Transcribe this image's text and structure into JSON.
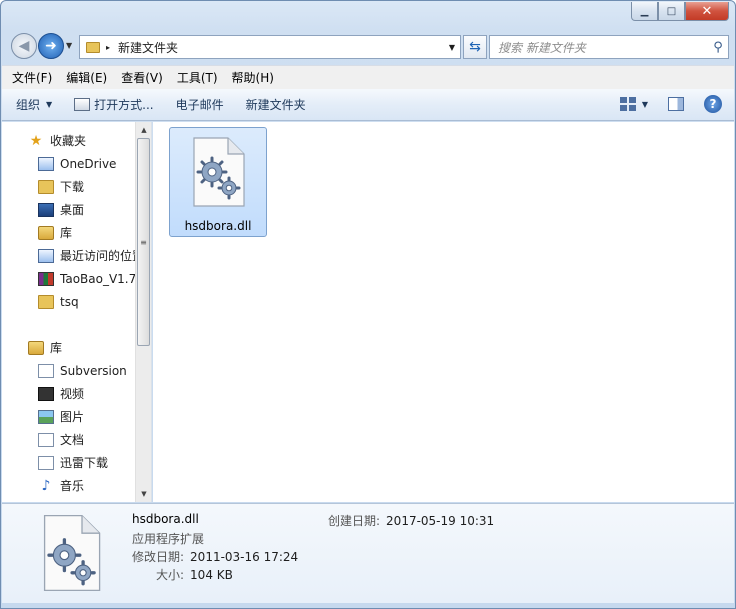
{
  "window": {
    "minimize_label": "▁",
    "maximize_label": "□",
    "close_label": "✕"
  },
  "nav": {
    "back_glyph": "◀",
    "forward_glyph": "➜"
  },
  "address": {
    "path": "新建文件夹",
    "separator": "▸"
  },
  "search": {
    "placeholder": "搜索 新建文件夹",
    "icon": "search-icon"
  },
  "menu": [
    "文件(F)",
    "编辑(E)",
    "查看(V)",
    "工具(T)",
    "帮助(H)"
  ],
  "toolbar": {
    "organize": "组织",
    "open_with": "打开方式...",
    "email": "电子邮件",
    "new_folder": "新建文件夹",
    "help": "?"
  },
  "sidebar": {
    "favorites_label": "收藏夹",
    "favorites": [
      "OneDrive",
      "下载",
      "桌面",
      "库",
      "最近访问的位置",
      "TaoBao_V1.7",
      "tsq"
    ],
    "library_label": "库",
    "libraries": [
      "Subversion",
      "视频",
      "图片",
      "文档",
      "迅雷下载",
      "音乐"
    ]
  },
  "files": [
    {
      "name": "hsdbora.dll",
      "icon": "dll-gear-icon",
      "selected": true
    }
  ],
  "details": {
    "name": "hsdbora.dll",
    "type": "应用程序扩展",
    "modified_label": "修改日期:",
    "modified_value": "2011-03-16 17:24",
    "size_label": "大小:",
    "size_value": "104 KB",
    "created_label": "创建日期:",
    "created_value": "2017-05-19 10:31"
  },
  "colors": {
    "accent": "#1f5fb3",
    "selection": "#c1dcfc",
    "selection_border": "#7da2ce"
  }
}
